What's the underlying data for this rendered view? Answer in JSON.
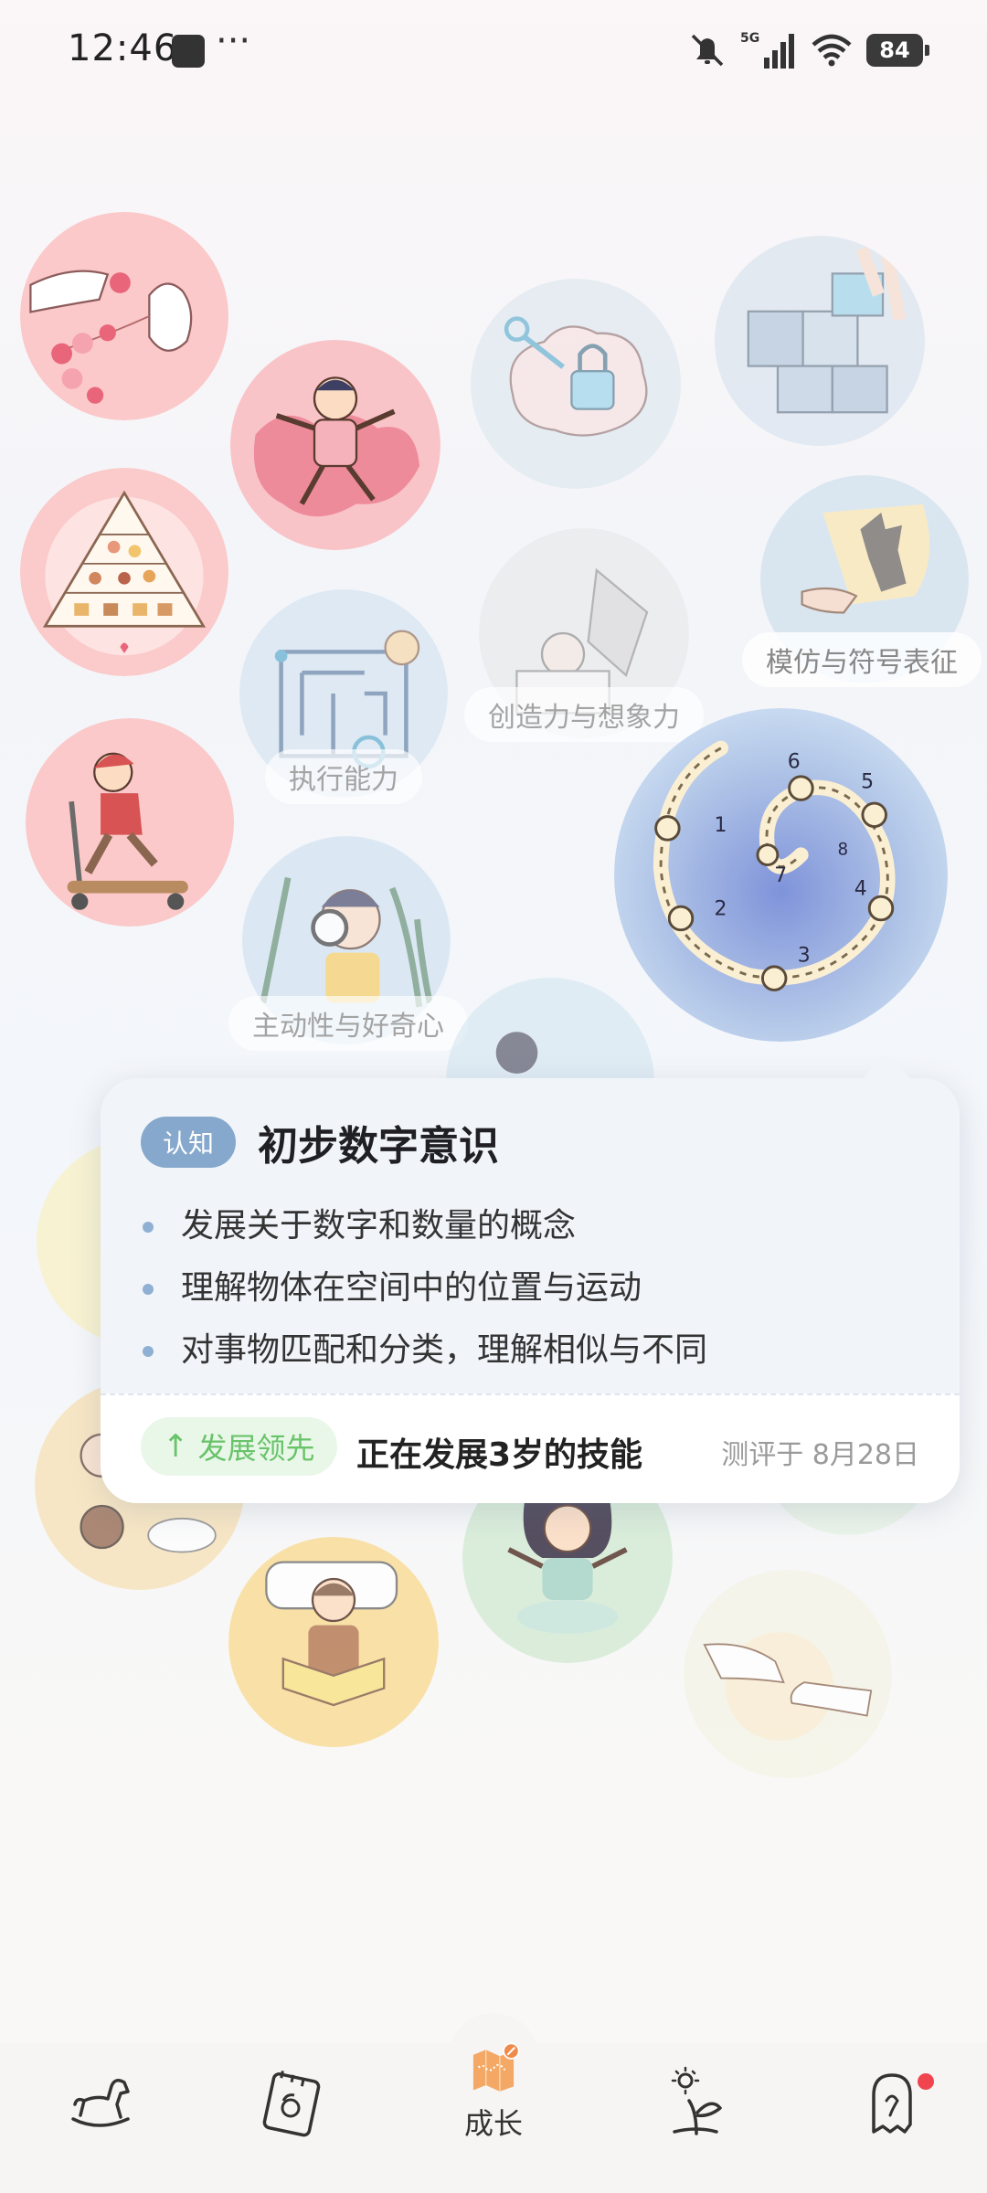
{
  "status_bar": {
    "time": "12:46",
    "more_glyph": "···",
    "battery": "84",
    "icons": [
      "mute-icon",
      "5g-signal-icon",
      "wifi-icon",
      "battery-icon"
    ]
  },
  "bubbles": {
    "imitation_label": "模仿与符号表征",
    "creativity_label": "创造力与想象力",
    "executive_label": "执行能力",
    "curiosity_label": "主动性与好奇心"
  },
  "card": {
    "category": "认知",
    "title": "初步数字意识",
    "points": [
      "发展关于数字和数量的概念",
      "理解物体在空间中的位置与运动",
      "对事物匹配和分类，理解相似与不同"
    ],
    "lead_badge": "发展领先",
    "status": "正在发展3岁的技能",
    "assessed": "测评于 8月28日"
  },
  "nav": {
    "items": [
      "rocking-horse-icon",
      "notebook-icon",
      "map-icon",
      "sprout-icon",
      "ghost-icon"
    ],
    "active_label": "成长",
    "active_color": "#f4a865"
  }
}
